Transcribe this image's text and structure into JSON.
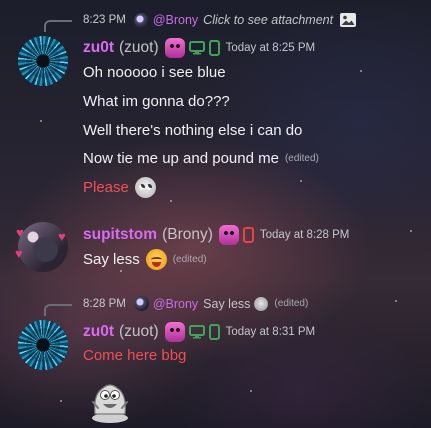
{
  "messages": [
    {
      "reply": {
        "time": "8:23 PM",
        "name": "@Brony",
        "text": "Click to see attachment",
        "attachment_icon": "image-icon"
      },
      "author": {
        "name": "zu0t",
        "tag": "(zuot)",
        "avatar": "avatar-zuot"
      },
      "timestamp": "Today at 8:25 PM",
      "lines": [
        {
          "text": "Oh nooooo i see blue"
        },
        {
          "text": "What im gonna do???"
        },
        {
          "text": "Well there's nothing else i can do"
        },
        {
          "text": "Now tie me up and pound me",
          "edited": "(edited)"
        },
        {
          "text": "Please",
          "emoji": "pleading-face-emoji"
        }
      ]
    },
    {
      "author": {
        "name": "supitstom",
        "tag": "(Brony)",
        "avatar": "avatar-supitstom"
      },
      "timestamp": "Today at 8:28 PM",
      "lines": [
        {
          "text": "Say less",
          "emoji": "drooling-face-emoji",
          "edited": "(edited)"
        }
      ]
    },
    {
      "reply": {
        "time": "8:28 PM",
        "name": "@Brony",
        "text": "Say less",
        "emoji": "drooling-face-emoji",
        "edited": "(edited)"
      },
      "author": {
        "name": "zu0t",
        "tag": "(zuot)",
        "avatar": "avatar-zuot"
      },
      "timestamp": "Today at 8:31 PM",
      "lines": [
        {
          "text": "Come here bbg"
        }
      ],
      "sticker": "cartoon-sticker"
    }
  ],
  "colors": {
    "username": "#d86bf0",
    "mention": "#c96ee8",
    "red_text": "#ef4f55",
    "device_green": "#3ba55d",
    "device_red": "#ed4245"
  }
}
